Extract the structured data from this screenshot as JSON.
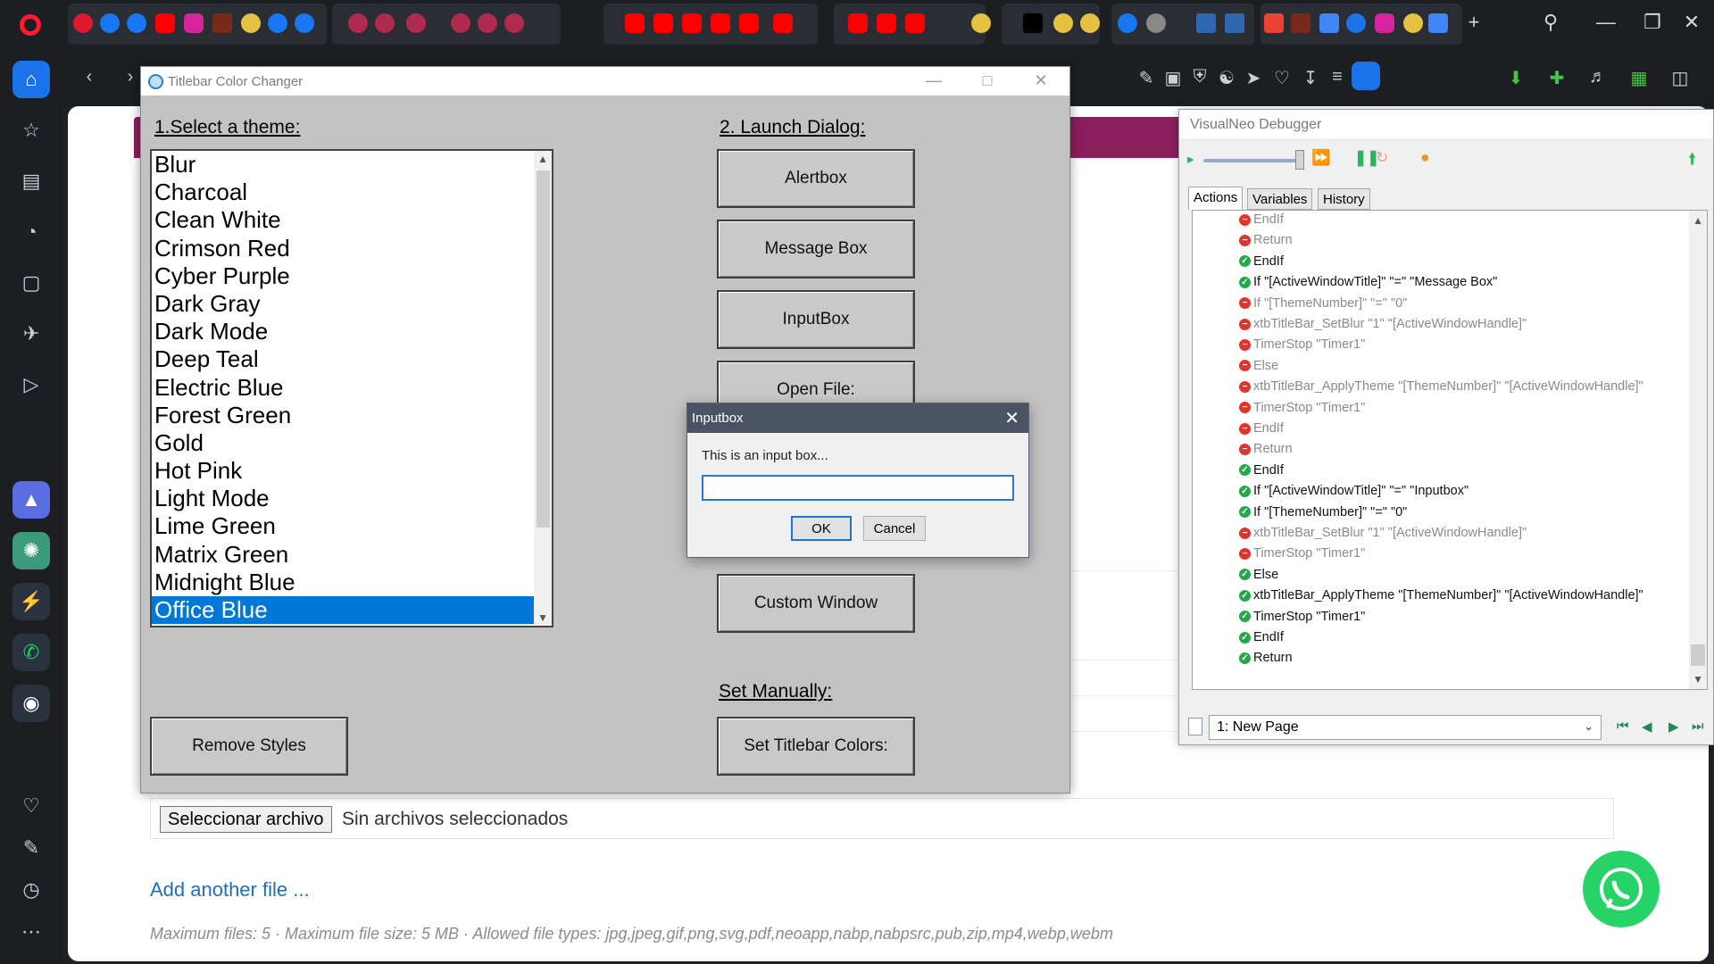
{
  "browser": {
    "window_controls": [
      "search-icon",
      "minimize-icon",
      "restore-icon",
      "close-icon"
    ],
    "accent": "#1a73e8"
  },
  "tcc_window": {
    "title": "Titlebar Color Changer",
    "select_theme_label": "1.Select a theme:",
    "launch_dialog_label": "2. Launch Dialog:",
    "set_manually_label": "Set Manually:",
    "themes": [
      "Blur",
      "Charcoal",
      "Clean White",
      "Crimson Red",
      "Cyber Purple",
      "Dark Gray",
      "Dark Mode",
      "Deep Teal",
      "Electric Blue",
      "Forest Green",
      "Gold",
      "Hot Pink",
      "Light Mode",
      "Lime Green",
      "Matrix Green",
      "Midnight Blue",
      "Office Blue"
    ],
    "selected_theme": "Office Blue",
    "buttons": {
      "alertbox": "Alertbox",
      "message_box": "Message Box",
      "inputbox": "InputBox",
      "open_file": "Open File:",
      "custom_window": "Custom Window",
      "remove_styles": "Remove Styles",
      "set_titlebar_colors": "Set Titlebar Colors:"
    }
  },
  "inputbox": {
    "title": "Inputbox",
    "prompt": "This is an input box...",
    "value": "",
    "ok": "OK",
    "cancel": "Cancel"
  },
  "debugger": {
    "title": "VisualNeo Debugger",
    "tabs": [
      "Actions",
      "Variables",
      "History"
    ],
    "active_tab": "Actions",
    "actions": [
      {
        "text": "EndIf",
        "status": "red",
        "indent": 1
      },
      {
        "text": "Return",
        "status": "red",
        "indent": 1
      },
      {
        "text": "EndIf",
        "status": "green",
        "indent": 0
      },
      {
        "text": "If \"[ActiveWindowTitle]\" \"=\" \"Message Box\"",
        "status": "green",
        "indent": 0
      },
      {
        "text": "If \"[ThemeNumber]\" \"=\" \"0\"",
        "status": "red",
        "indent": 1
      },
      {
        "text": "xtbTitleBar_SetBlur \"1\" \"[ActiveWindowHandle]\"",
        "status": "red",
        "indent": 1
      },
      {
        "text": "TimerStop \"Timer1\"",
        "status": "red",
        "indent": 1
      },
      {
        "text": "Else",
        "status": "red",
        "indent": 1
      },
      {
        "text": "xtbTitleBar_ApplyTheme \"[ThemeNumber]\" \"[ActiveWindowHandle]\"",
        "status": "red",
        "indent": 1
      },
      {
        "text": "TimerStop \"Timer1\"",
        "status": "red",
        "indent": 1
      },
      {
        "text": "EndIf",
        "status": "red",
        "indent": 1
      },
      {
        "text": "Return",
        "status": "red",
        "indent": 1
      },
      {
        "text": "EndIf",
        "status": "green",
        "indent": 0
      },
      {
        "text": "If \"[ActiveWindowTitle]\" \"=\" \"Inputbox\"",
        "status": "green",
        "indent": 0
      },
      {
        "text": "If \"[ThemeNumber]\" \"=\" \"0\"",
        "status": "green",
        "indent": 0
      },
      {
        "text": "xtbTitleBar_SetBlur \"1\" \"[ActiveWindowHandle]\"",
        "status": "red",
        "indent": 1
      },
      {
        "text": "TimerStop \"Timer1\"",
        "status": "red",
        "indent": 1
      },
      {
        "text": "Else",
        "status": "green",
        "indent": 0
      },
      {
        "text": "xtbTitleBar_ApplyTheme \"[ThemeNumber]\" \"[ActiveWindowHandle]\"",
        "status": "green",
        "indent": 0
      },
      {
        "text": "TimerStop \"Timer1\"",
        "status": "green",
        "indent": 0
      },
      {
        "text": "EndIf",
        "status": "green",
        "indent": 0
      },
      {
        "text": "Return",
        "status": "green",
        "indent": 0
      }
    ],
    "page_select": "1: New Page"
  },
  "webpage": {
    "file_button": "Seleccionar archivo",
    "file_status": "Sin archivos seleccionados",
    "add_file_link": "Add another file ...",
    "max_info": "Maximum files: 5 · Maximum file size: 5 MB · Allowed file types: jpg,jpeg,gif,png,svg,pdf,neoapp,nabp,nabpsrc,pub,zip,mp4,webp,webm"
  }
}
